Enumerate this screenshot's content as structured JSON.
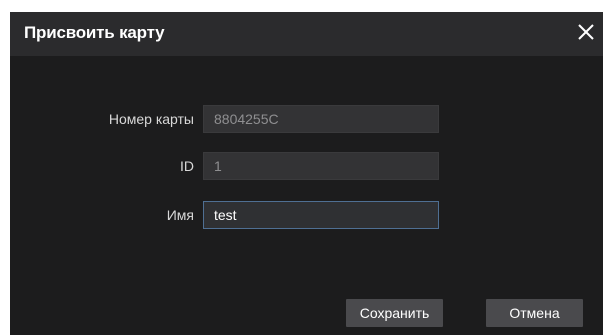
{
  "dialog": {
    "title": "Присвоить карту",
    "close_icon": "close-icon"
  },
  "form": {
    "card_number": {
      "label": "Номер карты",
      "value": "8804255C"
    },
    "id": {
      "label": "ID",
      "value": "1"
    },
    "name": {
      "label": "Имя",
      "value": "test"
    }
  },
  "buttons": {
    "save_label": "Сохранить",
    "cancel_label": "Отмена"
  },
  "colors": {
    "dialog_bg": "#1c1c1d",
    "titlebar_bg": "#2b2b2d",
    "field_focus_border": "#4f6f93",
    "button_bg": "#4a4a4d"
  }
}
